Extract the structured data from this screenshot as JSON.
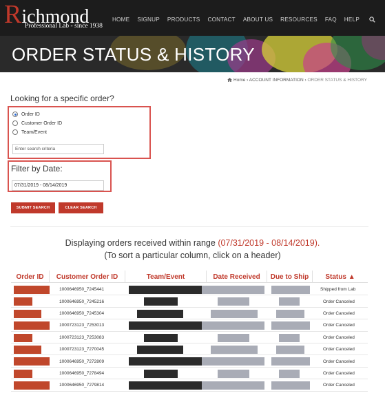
{
  "header": {
    "logo_letter": "R",
    "logo_rest": "ichmond",
    "logo_tagline": "Professional Lab - since 1938",
    "nav": [
      "HOME",
      "SIGNUP",
      "PRODUCTS",
      "CONTACT",
      "ABOUT US",
      "RESOURCES",
      "FAQ",
      "HELP"
    ],
    "search_icon": "search-icon"
  },
  "banner": {
    "title": "ORDER STATUS & HISTORY"
  },
  "breadcrumb": {
    "home": "Home",
    "sep": "›",
    "section": "ACCOUNT INFORMATION",
    "current": "ORDER STATUS & HISTORY"
  },
  "search": {
    "question": "Looking for a specific order?",
    "options": [
      {
        "label": "Order ID",
        "selected": true
      },
      {
        "label": "Customer Order ID",
        "selected": false
      },
      {
        "label": "Team/Event",
        "selected": false
      }
    ],
    "placeholder": "Enter search criteria"
  },
  "filter": {
    "label": "Filter by Date:",
    "value": "07/31/2019 - 08/14/2019"
  },
  "buttons": {
    "submit": "SUBMIT SEARCH",
    "clear": "CLEAR SEARCH"
  },
  "display": {
    "line1_prefix": "Displaying orders received within range",
    "range": "(07/31/2019 - 08/14/2019).",
    "line2": "(To sort a particular column, click on a header)"
  },
  "table": {
    "headers": [
      "Order ID",
      "Customer Order ID",
      "Team/Event",
      "Date Received",
      "Due to Ship",
      "Status ▲"
    ],
    "rows": [
      {
        "customer_order_id": "1000646950_7245441",
        "status": "Shipped from Lab"
      },
      {
        "customer_order_id": "1000646950_7245216",
        "status": "Order Canceled"
      },
      {
        "customer_order_id": "1000646950_7245304",
        "status": "Order Canceled"
      },
      {
        "customer_order_id": "1000723123_7253013",
        "status": "Order Canceled"
      },
      {
        "customer_order_id": "1000723123_7253083",
        "status": "Order Canceled"
      },
      {
        "customer_order_id": "1000723123_7270045",
        "status": "Order Canceled"
      },
      {
        "customer_order_id": "1000646950_7272809",
        "status": "Order Canceled"
      },
      {
        "customer_order_id": "1000646950_7278494",
        "status": "Order Canceled"
      },
      {
        "customer_order_id": "1000646950_7279814",
        "status": "Order Canceled"
      }
    ]
  },
  "colors": {
    "accent": "#c0392b",
    "highlight_box": "#d9534f",
    "header_bg": "#1c1c1c"
  }
}
